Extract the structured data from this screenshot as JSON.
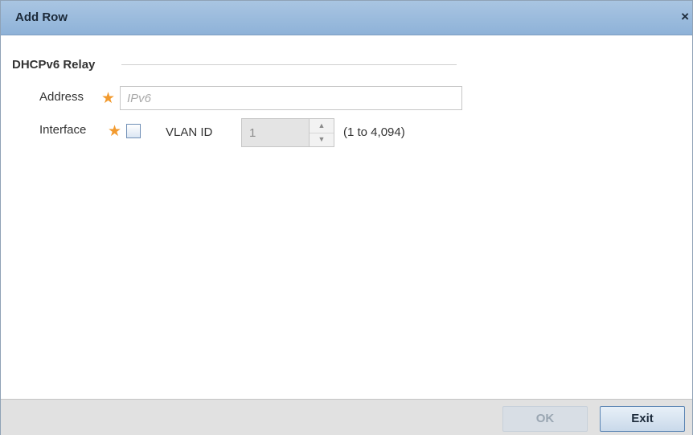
{
  "dialog": {
    "title": "Add Row",
    "close_glyph": "×"
  },
  "section": {
    "title": "DHCPv6 Relay"
  },
  "address": {
    "label": "Address",
    "required_glyph": "★",
    "placeholder": "IPv6",
    "value": ""
  },
  "interface": {
    "label": "Interface",
    "required_glyph": "★",
    "checked": false,
    "vlan_label": "VLAN ID",
    "vlan_value": "1",
    "vlan_range": "(1 to 4,094)",
    "spin_up_glyph": "▲",
    "spin_down_glyph": "▼"
  },
  "footer": {
    "ok_label": "OK",
    "exit_label": "Exit"
  },
  "colors": {
    "titlebar": "#9bbbe0",
    "required_star": "#f29a2e",
    "exit_border": "#5a84b3"
  }
}
